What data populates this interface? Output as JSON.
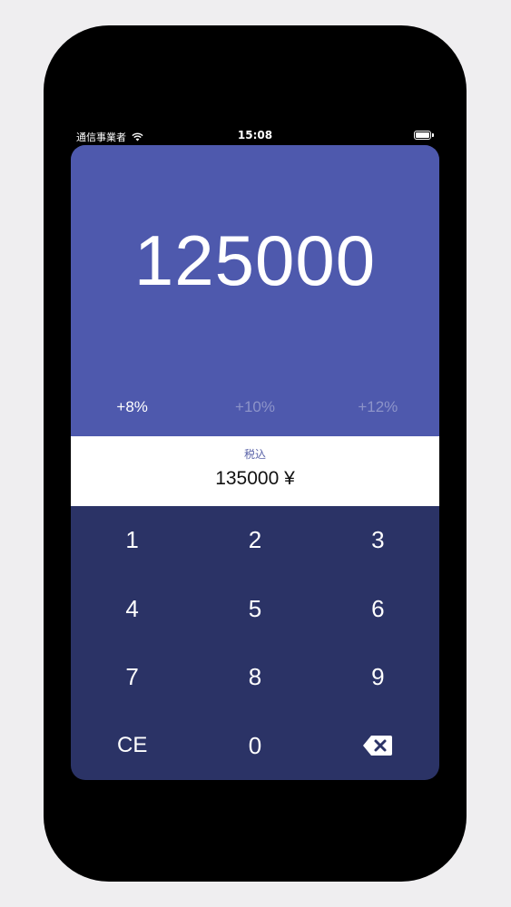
{
  "status_bar": {
    "carrier": "通信事業者",
    "time": "15:08",
    "icons": [
      "wifi-icon",
      "battery-icon"
    ]
  },
  "display": {
    "amount": "125000"
  },
  "tax_rates": [
    {
      "label": "+8%",
      "selected": true
    },
    {
      "label": "+10%",
      "selected": false
    },
    {
      "label": "+12%",
      "selected": false
    }
  ],
  "result": {
    "label": "税込",
    "value": "135000 ¥"
  },
  "keypad": {
    "keys": [
      "1",
      "2",
      "3",
      "4",
      "5",
      "6",
      "7",
      "8",
      "9",
      "CE",
      "0"
    ],
    "backspace_icon": "backspace-icon"
  },
  "colors": {
    "display_bg": "#4e59ad",
    "keypad_bg": "#2b3366",
    "result_bg": "#ffffff",
    "label_color": "#5a63a8",
    "inactive_rate": "#8d94c9"
  }
}
